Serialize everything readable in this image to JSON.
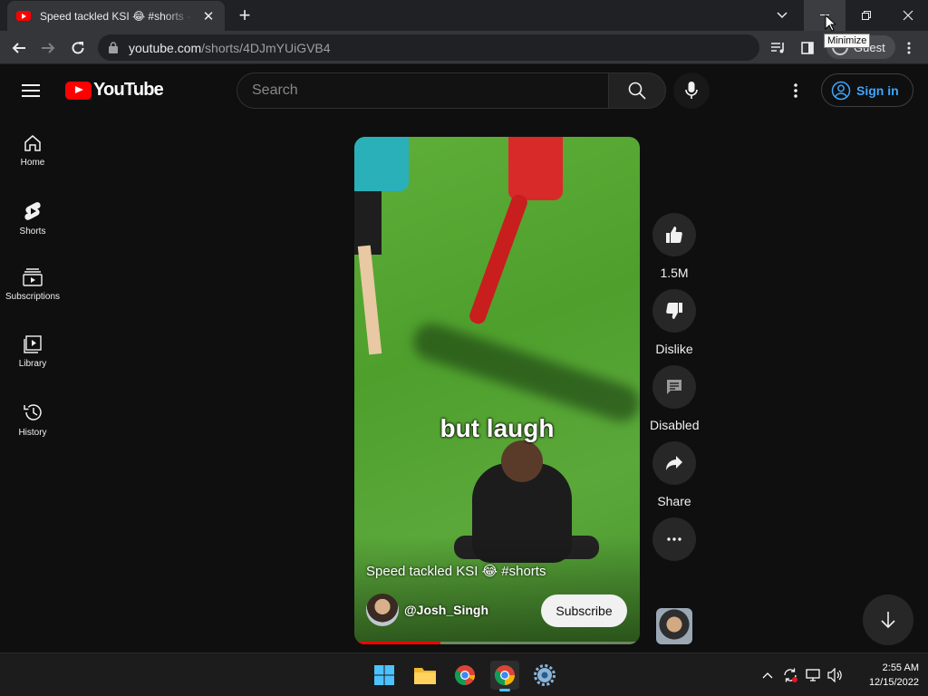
{
  "browser": {
    "tab_title": "Speed tackled KSI 😂 #shorts - YouTube",
    "url_host": "youtube.com",
    "url_path": "/shorts/4DJmYUiGVB4",
    "tooltip": "Minimize",
    "profile_label": "Guest"
  },
  "youtube": {
    "logo_text": "YouTube",
    "search_placeholder": "Search",
    "sign_in_label": "Sign in"
  },
  "sidebar": {
    "items": [
      {
        "label": "Home",
        "icon": "home-icon"
      },
      {
        "label": "Shorts",
        "icon": "shorts-icon"
      },
      {
        "label": "Subscriptions",
        "icon": "subscriptions-icon"
      },
      {
        "label": "Library",
        "icon": "library-icon"
      },
      {
        "label": "History",
        "icon": "history-icon"
      }
    ]
  },
  "short": {
    "caption": "but laugh",
    "title": "Speed tackled KSI 😂 #shorts",
    "channel": "@Josh_Singh",
    "subscribe_label": "Subscribe",
    "progress": 0.3
  },
  "actions": {
    "like_count": "1.5M",
    "dislike_label": "Dislike",
    "comments_label": "Disabled",
    "share_label": "Share"
  },
  "taskbar": {
    "time": "2:55 AM",
    "date": "12/15/2022"
  },
  "colors": {
    "brand_red": "#ff0000",
    "link_blue": "#3ea6ff",
    "background": "#0f0f0f"
  }
}
